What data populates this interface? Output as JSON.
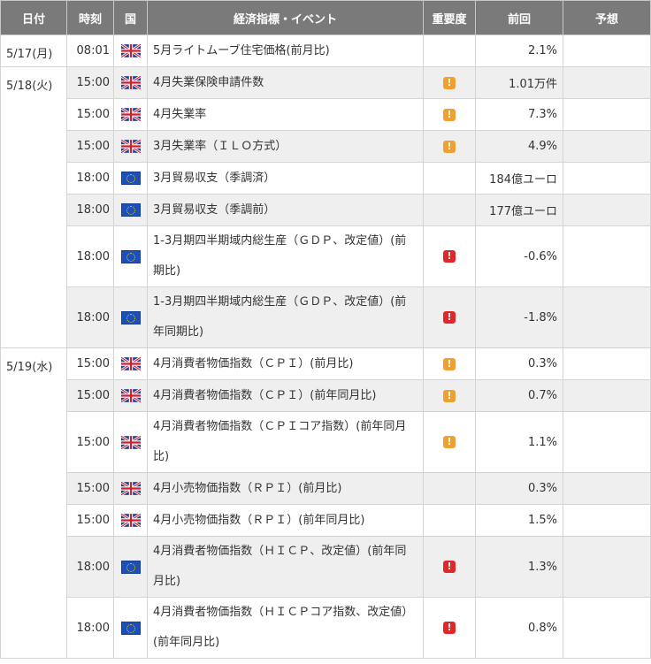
{
  "headers": {
    "date": "日付",
    "time": "時刻",
    "country": "国",
    "event": "経済指標・イベント",
    "importance": "重要度",
    "previous": "前回",
    "forecast": "予想"
  },
  "groups": [
    {
      "date": "5/17(月)",
      "rows": [
        {
          "time": "08:01",
          "country": "uk-flag-icon",
          "event": "5月ライトムーブ住宅価格(前月比)",
          "importance": "",
          "previous": "2.1%",
          "forecast": "",
          "alt": false,
          "h": 36
        }
      ]
    },
    {
      "date": "5/18(火)",
      "rows": [
        {
          "time": "15:00",
          "country": "uk-flag-icon",
          "event": "4月失業保険申請件数",
          "importance": "mid",
          "previous": "1.01万件",
          "forecast": "",
          "alt": true,
          "h": 36
        },
        {
          "time": "15:00",
          "country": "uk-flag-icon",
          "event": "4月失業率",
          "importance": "mid",
          "previous": "7.3%",
          "forecast": "",
          "alt": false,
          "h": 36
        },
        {
          "time": "15:00",
          "country": "uk-flag-icon",
          "event": "3月失業率（ＩＬＯ方式）",
          "importance": "mid",
          "previous": "4.9%",
          "forecast": "",
          "alt": true,
          "h": 36
        },
        {
          "time": "18:00",
          "country": "eu-flag-icon",
          "event": "3月貿易収支（季調済）",
          "importance": "",
          "previous": "184億ユーロ",
          "forecast": "",
          "alt": false,
          "h": 36
        },
        {
          "time": "18:00",
          "country": "eu-flag-icon",
          "event": "3月貿易収支（季調前）",
          "importance": "",
          "previous": "177億ユーロ",
          "forecast": "",
          "alt": true,
          "h": 36
        },
        {
          "time": "18:00",
          "country": "eu-flag-icon",
          "event": "1-3月期四半期域内総生産（ＧＤＰ、改定値）(前期比)",
          "importance": "high",
          "previous": "-0.6%",
          "forecast": "",
          "alt": false,
          "h": 69
        },
        {
          "time": "18:00",
          "country": "eu-flag-icon",
          "event": "1-3月期四半期域内総生産（ＧＤＰ、改定値）(前年同期比)",
          "importance": "high",
          "previous": "-1.8%",
          "forecast": "",
          "alt": true,
          "h": 69
        }
      ]
    },
    {
      "date": "5/19(水)",
      "rows": [
        {
          "time": "15:00",
          "country": "uk-flag-icon",
          "event": "4月消費者物価指数（ＣＰＩ）(前月比)",
          "importance": "mid",
          "previous": "0.3%",
          "forecast": "",
          "alt": false,
          "h": 36
        },
        {
          "time": "15:00",
          "country": "uk-flag-icon",
          "event": "4月消費者物価指数（ＣＰＩ）(前年同月比)",
          "importance": "mid",
          "previous": "0.7%",
          "forecast": "",
          "alt": true,
          "h": 36
        },
        {
          "time": "15:00",
          "country": "uk-flag-icon",
          "event": "4月消費者物価指数（ＣＰＩコア指数）(前年同月比)",
          "importance": "mid",
          "previous": "1.1%",
          "forecast": "",
          "alt": false,
          "h": 69
        },
        {
          "time": "15:00",
          "country": "uk-flag-icon",
          "event": "4月小売物価指数（ＲＰＩ）(前月比)",
          "importance": "",
          "previous": "0.3%",
          "forecast": "",
          "alt": true,
          "h": 36
        },
        {
          "time": "15:00",
          "country": "uk-flag-icon",
          "event": "4月小売物価指数（ＲＰＩ）(前年同月比)",
          "importance": "",
          "previous": "1.5%",
          "forecast": "",
          "alt": false,
          "h": 36
        },
        {
          "time": "18:00",
          "country": "eu-flag-icon",
          "event": "4月消費者物価指数（ＨＩＣＰ、改定値）(前年同月比)",
          "importance": "high",
          "previous": "1.3%",
          "forecast": "",
          "alt": true,
          "h": 69
        },
        {
          "time": "18:00",
          "country": "eu-flag-icon",
          "event": "4月消費者物価指数（ＨＩＣＰコア指数、改定値）(前年同月比)",
          "importance": "high",
          "previous": "0.8%",
          "forecast": "",
          "alt": false,
          "h": 69
        }
      ]
    }
  ],
  "importance_symbol": "!",
  "colors": {
    "header_bg": "#7a7a7a",
    "alt_row": "#efefef",
    "importance_mid": "#f0a030",
    "importance_high": "#e02828"
  }
}
